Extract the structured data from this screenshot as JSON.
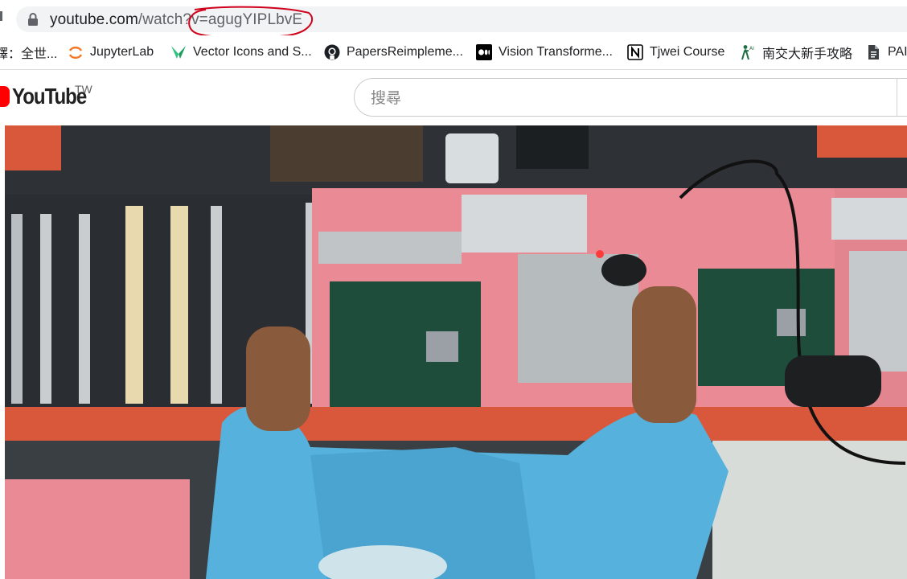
{
  "browser": {
    "url_host": "youtube.com",
    "url_path": "/watch?v=agugYIPLbvE",
    "annotation_color": "#d0021b"
  },
  "bookmarks": [
    {
      "label": "譯：全世...",
      "icon": "translate-icon"
    },
    {
      "label": "JupyterLab",
      "icon": "jupyter-icon"
    },
    {
      "label": "Vector Icons and S...",
      "icon": "vector-icons-icon"
    },
    {
      "label": "PapersReimpleme...",
      "icon": "github-icon"
    },
    {
      "label": "Vision Transforme...",
      "icon": "medium-icon"
    },
    {
      "label": "Tjwei Course",
      "icon": "notion-icon"
    },
    {
      "label": "南交大新手攻略",
      "icon": "person-ai-icon"
    },
    {
      "label": "PAI",
      "icon": "document-icon"
    }
  ],
  "youtube": {
    "logo_text": "YouTube",
    "region": "TW",
    "search_placeholder": "搜尋",
    "brand_color": "#ff0000"
  }
}
